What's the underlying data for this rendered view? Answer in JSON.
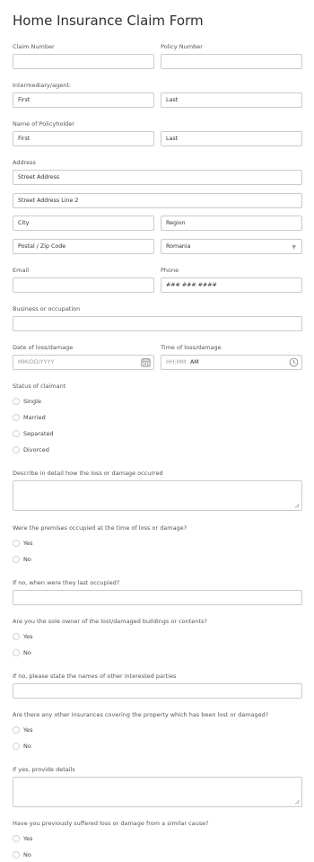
{
  "form": {
    "title": "Home Insurance Claim Form"
  },
  "labels": {
    "claim_number": "Claim Number",
    "policy_number": "Policy Number",
    "intermediary": "Intermediary/agent:",
    "policyholder": "Name of Policyholder",
    "address": "Address",
    "email": "Email",
    "phone": "Phone",
    "business": "Business or occupation",
    "date_of_loss": "Date of loss/damage",
    "time_of_loss": "Time of loss/damage",
    "status": "Status of claimant",
    "describe": "Describe in detail how the loss or damage occurred",
    "premises_occupied": "Were the premises occupied at the time of loss or damage?",
    "last_occupied": "If no, when were they last occupied?",
    "sole_owner": "Are you the sole owner of the lost/damaged buildings or contents?",
    "interested_parties": "If no, please state the names of other interested parties",
    "other_insurances": "Are there any other insurances covering the property which has been lost or damaged?",
    "provide_details": "If yes, provide details",
    "previous_loss": "Have you previously suffered loss or damage from a similar cause?"
  },
  "placeholders": {
    "first": "First",
    "last": "Last",
    "street": "Street Address",
    "street2": "Street Address Line 2",
    "city": "City",
    "region": "Region",
    "postal": "Postal / Zip Code",
    "phone": "### ### ####",
    "date": "MM/DD/YYYY",
    "time": "HH:MM",
    "ampm": "AM"
  },
  "values": {
    "country": "Romania"
  },
  "options": {
    "status": [
      "Single",
      "Married",
      "Separated",
      "Divorced"
    ],
    "yes": "Yes",
    "no": "No"
  },
  "icons": {
    "calendar": "calendar-icon",
    "clock": "clock-icon",
    "dropdown": "chevron-down-icon"
  },
  "colors": {
    "border": "#c8ccd0",
    "text": "#444444",
    "title": "#2f2f2f"
  }
}
